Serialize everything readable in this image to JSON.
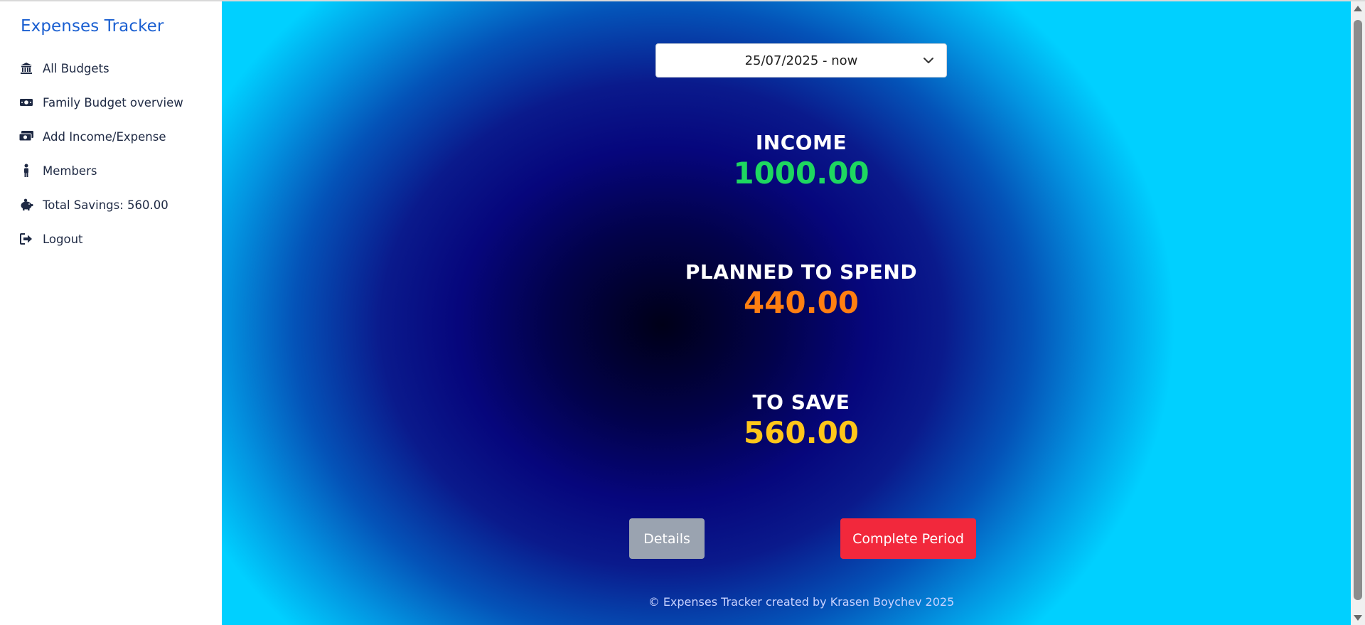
{
  "app": {
    "title": "Expenses Tracker"
  },
  "sidebar": {
    "items": [
      {
        "label": "All Budgets",
        "icon": "bank-icon"
      },
      {
        "label": "Family Budget overview",
        "icon": "money-bill-icon"
      },
      {
        "label": "Add Income/Expense",
        "icon": "money-bills-icon"
      },
      {
        "label": "Members",
        "icon": "person-icon"
      },
      {
        "label": "Total Savings: 560.00",
        "icon": "piggy-bank-icon"
      },
      {
        "label": "Logout",
        "icon": "logout-icon"
      }
    ]
  },
  "main": {
    "period": {
      "selected": "25/07/2025 - now"
    },
    "income": {
      "label": "INCOME",
      "value": "1000.00"
    },
    "planned": {
      "label": "PLANNED TO SPEND",
      "value": "440.00"
    },
    "save": {
      "label": "TO SAVE",
      "value": "560.00"
    },
    "buttons": {
      "details": "Details",
      "complete": "Complete Period"
    },
    "footer": "© Expenses Tracker created by Krasen Boychev 2025"
  },
  "colors": {
    "brand": "#1a5fd1",
    "income": "#1ed760",
    "planned": "#ff7f11",
    "save": "#ffc61a",
    "details_button": "#9aa3b0",
    "complete_button": "#f2283c"
  }
}
